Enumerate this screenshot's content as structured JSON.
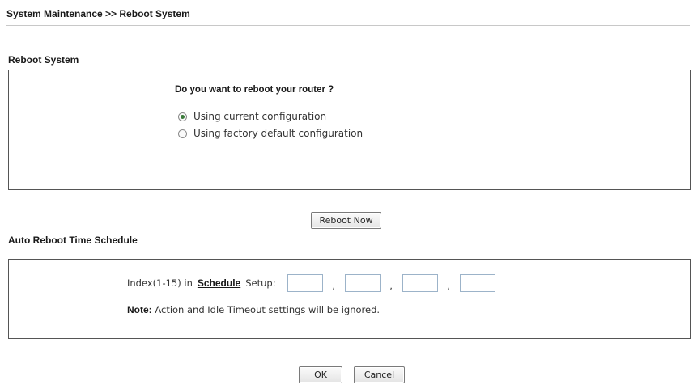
{
  "breadcrumb": "System Maintenance >> Reboot System",
  "reboot_section": {
    "title": "Reboot System",
    "question": "Do you want to reboot your router ?",
    "options": [
      {
        "label": "Using current configuration",
        "selected": true
      },
      {
        "label": "Using factory default configuration",
        "selected": false
      }
    ],
    "reboot_button": "Reboot Now"
  },
  "schedule_section": {
    "title": "Auto Reboot Time Schedule",
    "index_prefix": "Index(1-15) in",
    "schedule_link": "Schedule",
    "setup_suffix": "Setup:",
    "separator": ",",
    "index_values": [
      "",
      "",
      "",
      ""
    ],
    "note_label": "Note:",
    "note_text": "Action and Idle Timeout settings will be ignored."
  },
  "footer": {
    "ok_label": "OK",
    "cancel_label": "Cancel"
  }
}
